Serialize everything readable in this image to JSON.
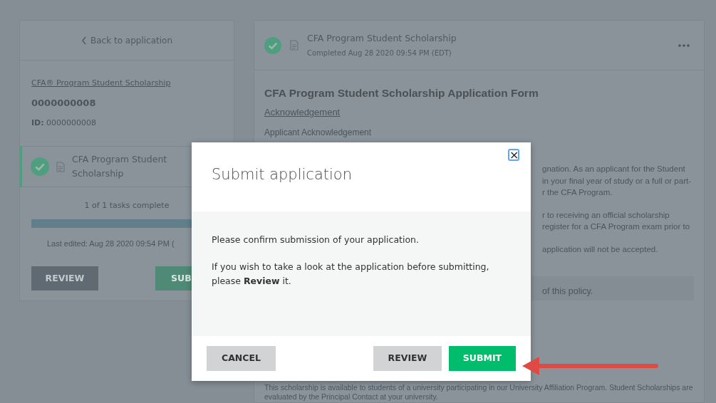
{
  "sidebar": {
    "back_link": "Back to application",
    "program_link": "CFA® Program Student Scholarship",
    "number": "0000000008",
    "id_line": "**ID:** 0000000008",
    "task": {
      "title": "CFA Program Student Scholarship",
      "completed": true,
      "selected": true
    },
    "progress_text": "1 of 1 tasks complete",
    "progress": {
      "level": 1
    },
    "last_edited": "Last edited: Aug 28 2020 09:54 PM (",
    "buttons": [
      {
        "label": "REVIEW",
        "kind": "secondary"
      },
      {
        "label": "SUB",
        "kind": "primary"
      }
    ]
  },
  "main": {
    "header": {
      "title": "CFA Program Student Scholarship",
      "subtitle": "Completed Aug 28 2020 09:54 PM (EDT)",
      "completed": true
    },
    "form_title": "CFA Program Student Scholarship Application Form",
    "section_link": "Acknowledgement",
    "section_label": "Applicant Acknowledgement",
    "paragraph_fragments": [
      [
        "gnation. As an applicant for the Student",
        "in your final year of study or a full or part-",
        "r the CFA Program."
      ],
      [
        "r to receiving an official scholarship",
        "register for a CFA Program exam prior to"
      ],
      [
        "application will not be accepted."
      ]
    ],
    "policy_fragment": "of this policy.",
    "footer_paragraph": "This scholarship is available to students of a university participating in our University Affiliation Program. Student Scholarships are evaluated by the Principal Contact at your university."
  },
  "modal": {
    "title": "Submit application",
    "close": "×",
    "paragraphs": [
      "Please confirm submission of your application.",
      "If you wish to take a look at the application before submitting, please **Review** it."
    ],
    "buttons": [
      {
        "label": "CANCEL",
        "kind": "secondary"
      },
      {
        "label": "REVIEW",
        "kind": "secondary"
      },
      {
        "label": "SUBMIT",
        "kind": "primary"
      }
    ]
  }
}
